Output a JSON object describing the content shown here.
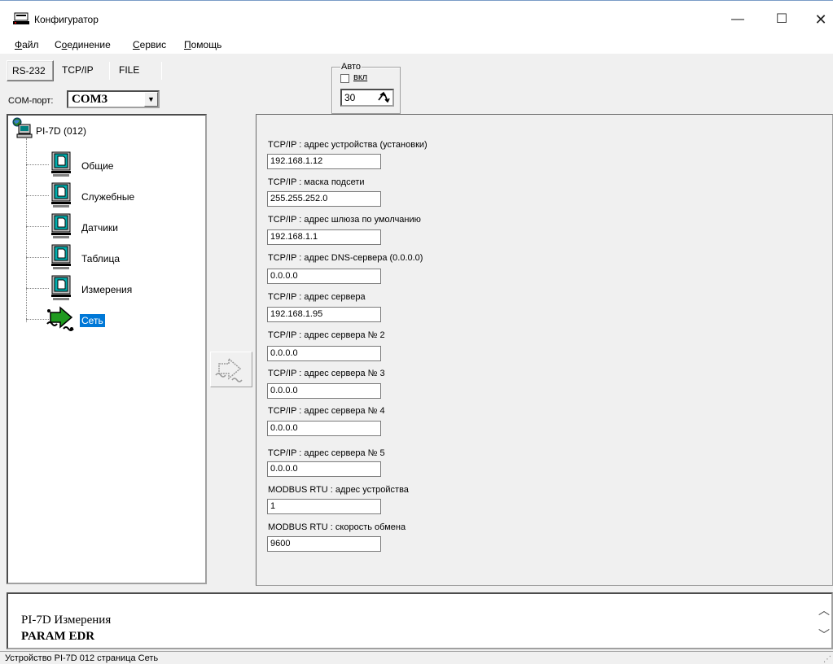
{
  "window": {
    "title": "Конфигуратор",
    "minimize": "—",
    "maximize": "☐",
    "close": "✕"
  },
  "menu": [
    {
      "pre": "",
      "ul": "Ф",
      "post": "айл"
    },
    {
      "pre": "С",
      "ul": "о",
      "post": "единение"
    },
    {
      "pre": "",
      "ul": "С",
      "post": "ервис"
    },
    {
      "pre": "",
      "ul": "П",
      "post": "омощь"
    }
  ],
  "connection_tabs": [
    "RS-232",
    "TCP/IP",
    "FILE"
  ],
  "com_port": {
    "label": "COM-порт:",
    "value": "COM3"
  },
  "auto": {
    "legend": "Авто",
    "checkbox_label": "вкл",
    "checked": false,
    "interval": "30"
  },
  "tree": {
    "root": "PI-7D  (012)",
    "items": [
      {
        "label": "Общие",
        "icon": "page-icon"
      },
      {
        "label": "Служебные",
        "icon": "page-icon"
      },
      {
        "label": "Датчики",
        "icon": "page-icon"
      },
      {
        "label": "Таблица",
        "icon": "page-icon"
      },
      {
        "label": "Измерения",
        "icon": "page-icon"
      },
      {
        "label": "Сеть",
        "icon": "network-arrow-icon",
        "selected": true
      }
    ]
  },
  "fields": [
    {
      "label": "TCP/IP : адрес устройства (установки)",
      "value": "192.168.1.12"
    },
    {
      "label": "TCP/IP : маска подсети",
      "value": "255.255.252.0"
    },
    {
      "label": "TCP/IP : адрес шлюза по умолчанию",
      "value": "192.168.1.1"
    },
    {
      "label": "TCP/IP : адрес DNS-сервера (0.0.0.0)",
      "value": "0.0.0.0"
    },
    {
      "label": "TCP/IP : адрес сервера",
      "value": "192.168.1.95"
    },
    {
      "label": "TCP/IP : адрес сервера № 2",
      "value": "0.0.0.0"
    },
    {
      "label": "TCP/IP : адрес сервера № 3",
      "value": "0.0.0.0"
    },
    {
      "label": "TCP/IP : адрес сервера № 4",
      "value": "0.0.0.0"
    },
    {
      "label": "TCP/IP : адрес сервера № 5",
      "value": "0.0.0.0"
    },
    {
      "label": "MODBUS RTU : адрес устройства",
      "value": "1"
    },
    {
      "label": "MODBUS RTU : скорость обмена",
      "value": "9600"
    }
  ],
  "log": {
    "line1": "PI-7D Измерения",
    "line2": "PARAM  EDR"
  },
  "status": {
    "text": "Устройство PI-7D 012  страница Сеть"
  },
  "colors": {
    "selection": "#0078d7",
    "face": "#f0f0f0"
  }
}
